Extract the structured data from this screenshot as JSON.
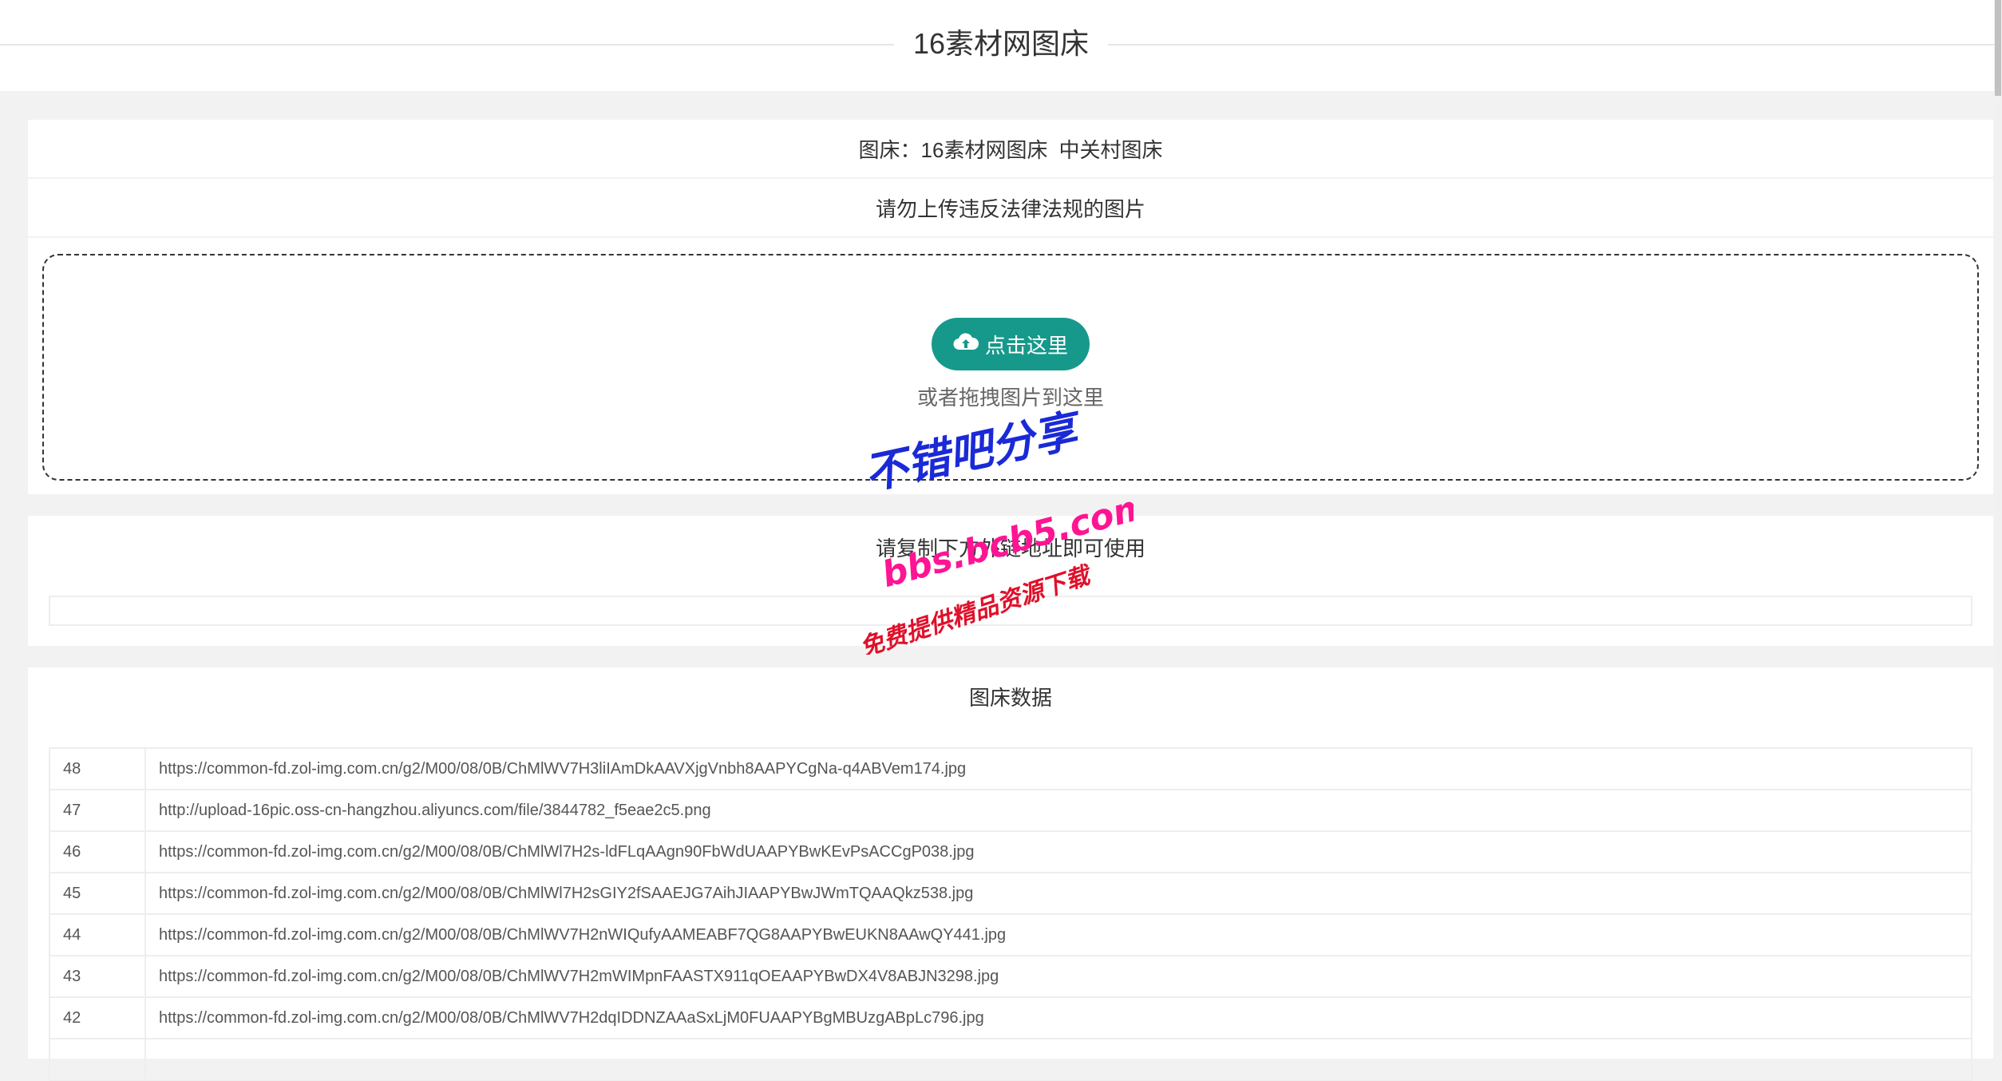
{
  "header": {
    "title": "16素材网图床"
  },
  "hosts": {
    "label": "图床：",
    "options": [
      "16素材网图床",
      "中关村图床"
    ]
  },
  "notice": "请勿上传违反法律法规的图片",
  "upload": {
    "button_label": "点击这里",
    "icon": "cloud-upload-icon",
    "drag_hint": "或者拖拽图片到这里"
  },
  "links": {
    "tip": "请复制下方外链地址即可使用",
    "value": ""
  },
  "data_table": {
    "title": "图床数据",
    "rows": [
      {
        "id": "48",
        "url": "https://common-fd.zol-img.com.cn/g2/M00/08/0B/ChMlWV7H3liIAmDkAAVXjgVnbh8AAPYCgNa-q4ABVem174.jpg"
      },
      {
        "id": "47",
        "url": "http://upload-16pic.oss-cn-hangzhou.aliyuncs.com/file/3844782_f5eae2c5.png"
      },
      {
        "id": "46",
        "url": "https://common-fd.zol-img.com.cn/g2/M00/08/0B/ChMlWl7H2s-ldFLqAAgn90FbWdUAAPYBwKEvPsACCgP038.jpg"
      },
      {
        "id": "45",
        "url": "https://common-fd.zol-img.com.cn/g2/M00/08/0B/ChMlWl7H2sGIY2fSAAEJG7AihJIAAPYBwJWmTQAAQkz538.jpg"
      },
      {
        "id": "44",
        "url": "https://common-fd.zol-img.com.cn/g2/M00/08/0B/ChMlWV7H2nWIQufyAAMEABF7QG8AAPYBwEUKN8AAwQY441.jpg"
      },
      {
        "id": "43",
        "url": "https://common-fd.zol-img.com.cn/g2/M00/08/0B/ChMlWV7H2mWIMpnFAASTX911qOEAAPYBwDX4V8ABJN3298.jpg"
      },
      {
        "id": "42",
        "url": "https://common-fd.zol-img.com.cn/g2/M00/08/0B/ChMlWV7H2dqIDDNZAAaSxLjM0FUAAPYBgMBUzgABpLc796.jpg"
      },
      {
        "id": "",
        "url": ""
      }
    ]
  },
  "watermark": {
    "line1": "不错吧分享",
    "line2": "bbs.bcb5.com",
    "line3": "免费提供精品资源下载"
  },
  "colors": {
    "accent": "#16998a",
    "watermark_blue": "#1a2ad6",
    "watermark_pink": "#ff1493",
    "watermark_red": "#e0102a"
  }
}
